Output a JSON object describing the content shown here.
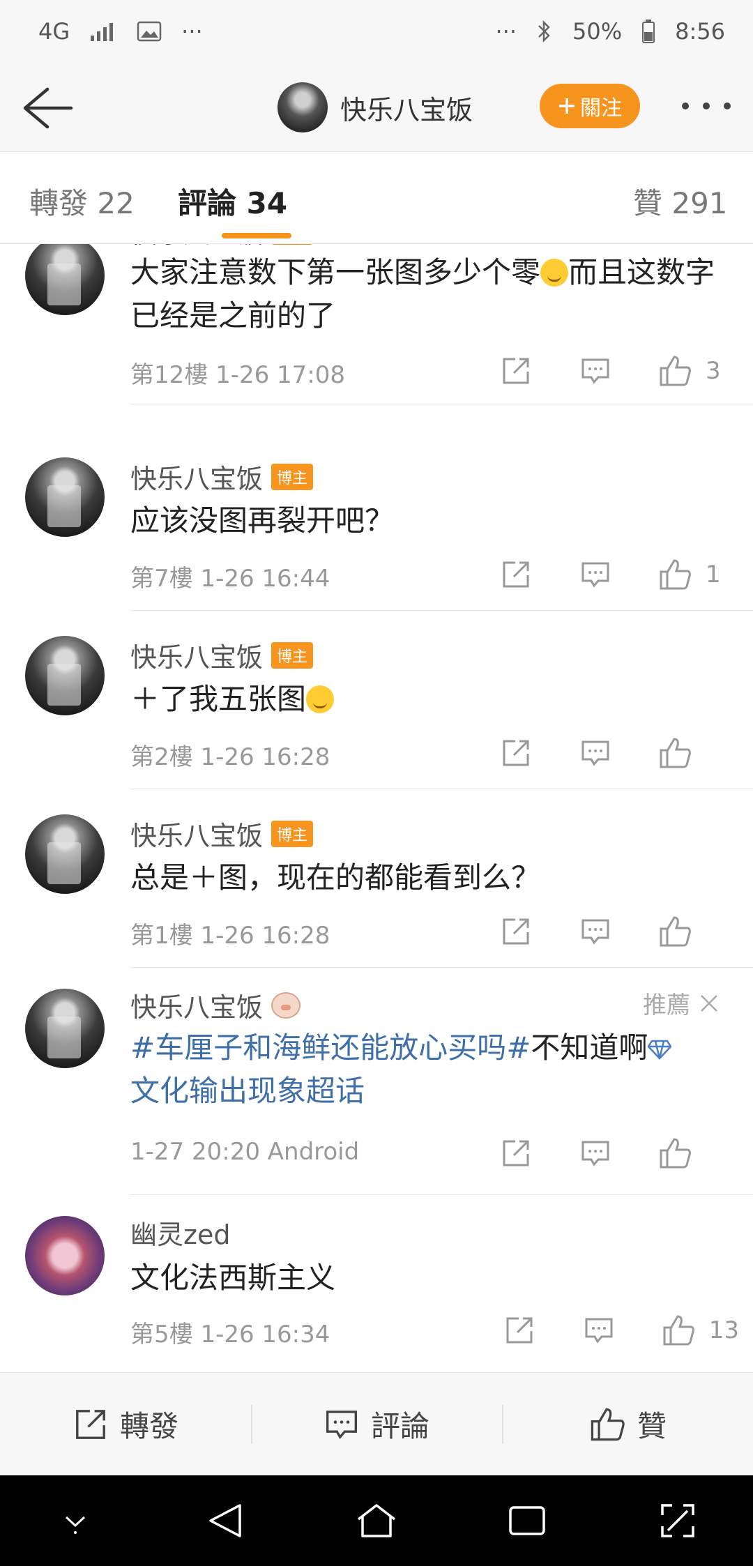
{
  "status_bar": {
    "network": "4G",
    "dots_left": "···",
    "dots_right": "···",
    "battery": "50%",
    "time": "8:56"
  },
  "header": {
    "username": "快乐八宝饭",
    "follow_label": "關注"
  },
  "tabs": [
    {
      "label": "轉發 22"
    },
    {
      "label": "評論 34"
    },
    {
      "label": "贊 291"
    }
  ],
  "comments": [
    {
      "user": "快乐八宝饭",
      "badge": "博主",
      "text1": "大家注意数下第一张图多少个零",
      "text2": "而且这数字已经是之前的了",
      "meta": "第12樓  1-26 17:08",
      "likes": "3"
    },
    {
      "user": "快乐八宝饭",
      "badge": "博主",
      "text1": "应该没图再裂开吧？",
      "meta": "第7樓  1-26 16:44",
      "likes": "1"
    },
    {
      "user": "快乐八宝饭",
      "badge": "博主",
      "text1": "＋了我五张图",
      "meta": "第2樓  1-26 16:28",
      "likes": ""
    },
    {
      "user": "快乐八宝饭",
      "badge": "博主",
      "text1": "总是＋图，现在的都能看到么？",
      "meta": "第1樓  1-26 16:28",
      "likes": ""
    },
    {
      "user": "快乐八宝饭",
      "recommend": "推薦",
      "topic": "#车厘子和海鲜还能放心买吗#",
      "text1": "不知道啊",
      "text2": "文化输出现象超话",
      "meta": "1-27 20:20  Android",
      "likes": ""
    },
    {
      "user": "幽灵zed",
      "text1": "文化法西斯主义",
      "meta": "第5樓  1-26 16:34",
      "likes": "13"
    }
  ],
  "bottom_bar": {
    "repost": "轉發",
    "comment": "評論",
    "like": "贊"
  }
}
